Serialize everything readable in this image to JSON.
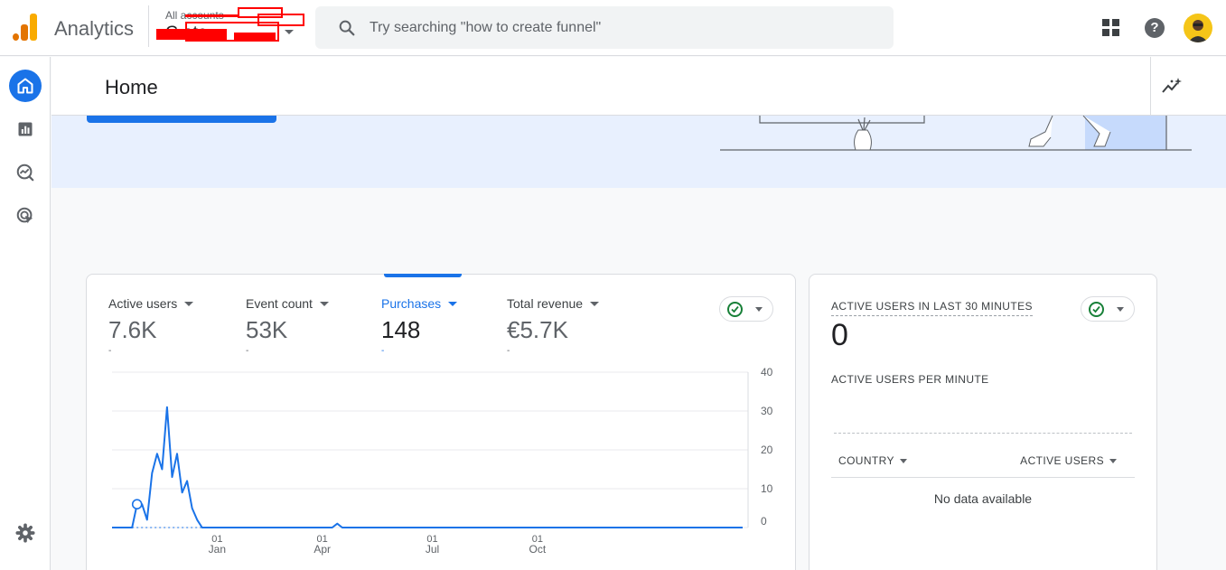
{
  "app": {
    "name": "Analytics",
    "account_breadcrumb": "All accounts",
    "account_property": "G             ate",
    "search_placeholder": "Try searching \"how to create funnel\"",
    "colors": {
      "accent": "#1a73e8",
      "logo_orange": "#f9ab00",
      "logo_dark": "#e37400",
      "success": "#188038"
    }
  },
  "nav": {
    "items": [
      {
        "name": "Home",
        "icon": "home-icon",
        "active": true
      },
      {
        "name": "Reports",
        "icon": "bar-chart-icon",
        "active": false
      },
      {
        "name": "Explore",
        "icon": "explore-icon",
        "active": false
      },
      {
        "name": "Advertising",
        "icon": "target-cursor-icon",
        "active": false
      }
    ],
    "settings_icon": "gear-icon"
  },
  "page": {
    "title": "Home",
    "insights_icon": "sparkline-insights-icon"
  },
  "overview": {
    "metrics": [
      {
        "label": "Active users",
        "value": "7.6K",
        "sub": "-",
        "selected": false
      },
      {
        "label": "Event count",
        "value": "53K",
        "sub": "-",
        "selected": false
      },
      {
        "label": "Purchases",
        "value": "148",
        "sub": "-",
        "selected": true
      },
      {
        "label": "Total revenue",
        "value": "€5.7K",
        "sub": "-",
        "selected": false
      }
    ]
  },
  "chart_data": {
    "type": "line",
    "series": [
      {
        "values": [
          0,
          0,
          0,
          0,
          0,
          6,
          6,
          2,
          14,
          19,
          15,
          31,
          13,
          19,
          9,
          12,
          5,
          2,
          0,
          0,
          0,
          0,
          0,
          0,
          0,
          0,
          0,
          0,
          0,
          0,
          0,
          0,
          0,
          0,
          0,
          0,
          0,
          0,
          0,
          0,
          0,
          0,
          0,
          0,
          0,
          1,
          0,
          0,
          0,
          0,
          0,
          0,
          0,
          0,
          0,
          0,
          0,
          0,
          0,
          0,
          0,
          0,
          0,
          0,
          0,
          0,
          0,
          0,
          0,
          0,
          0,
          0,
          0,
          0,
          0,
          0,
          0,
          0,
          0,
          0,
          0,
          0,
          0,
          0,
          0,
          0,
          0,
          0,
          0,
          0,
          0,
          0,
          0,
          0,
          0,
          0,
          0,
          0,
          0,
          0,
          0,
          0,
          0,
          0,
          0,
          0,
          0,
          0,
          0,
          0,
          0,
          0,
          0,
          0,
          0,
          0,
          0,
          0,
          0,
          0,
          0,
          0,
          0,
          0,
          0,
          0,
          0
        ]
      }
    ],
    "x_tick_labels": [
      {
        "day": "01",
        "month": "Jan"
      },
      {
        "day": "01",
        "month": "Apr"
      },
      {
        "day": "01",
        "month": "Jul"
      },
      {
        "day": "01",
        "month": "Oct"
      }
    ],
    "y_ticks": [
      "40",
      "30",
      "20",
      "10",
      "0"
    ],
    "ylim": [
      0,
      40
    ],
    "grid": true
  },
  "realtime": {
    "title": "ACTIVE USERS IN LAST 30 MINUTES",
    "value": "0",
    "per_minute_label": "ACTIVE USERS PER MINUTE",
    "table_headers": [
      "COUNTRY",
      "ACTIVE USERS"
    ],
    "empty_text": "No data available"
  }
}
